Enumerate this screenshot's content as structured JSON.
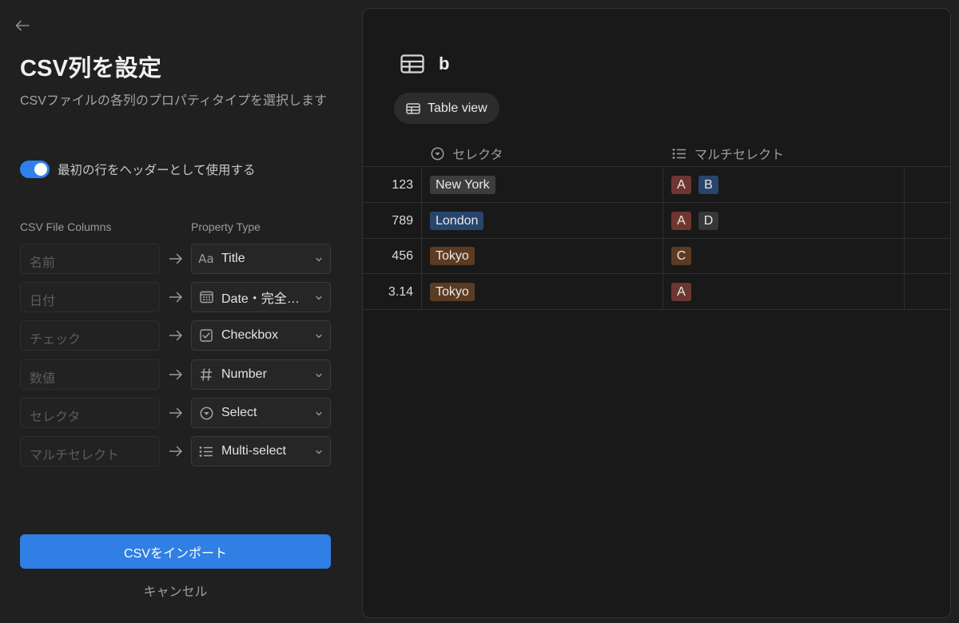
{
  "left": {
    "title": "CSV列を設定",
    "subtitle": "CSVファイルの各列のプロパティタイプを選択します",
    "toggle": {
      "label": "最初の行をヘッダーとして使用する",
      "on": true
    },
    "csv_columns_header": "CSV File Columns",
    "property_type_header": "Property Type",
    "mappings": [
      {
        "column": "名前",
        "type": "Title",
        "icon": "title-aa-icon"
      },
      {
        "column": "日付",
        "type": "Date・完全一致",
        "icon": "calendar-icon"
      },
      {
        "column": "チェック",
        "type": "Checkbox",
        "icon": "checkbox-icon"
      },
      {
        "column": "数値",
        "type": "Number",
        "icon": "hash-icon"
      },
      {
        "column": "セレクタ",
        "type": "Select",
        "icon": "select-icon"
      },
      {
        "column": "マルチセレクト",
        "type": "Multi-select",
        "icon": "list-icon"
      }
    ],
    "import_label": "CSVをインポート",
    "cancel_label": "キャンセル",
    "accent": "#2f7fe4"
  },
  "right": {
    "db_title": "b",
    "view_label": "Table view",
    "columns": [
      {
        "name": "セレクタ",
        "icon": "select-icon"
      },
      {
        "name": "マルチセレクト",
        "icon": "list-icon"
      }
    ],
    "rows": [
      {
        "number": "123",
        "select": "New York",
        "multi": [
          "A",
          "B"
        ]
      },
      {
        "number": "789",
        "select": "London",
        "multi": [
          "A",
          "D"
        ]
      },
      {
        "number": "456",
        "select": "Tokyo",
        "multi": [
          "C"
        ]
      },
      {
        "number": "3.14",
        "select": "Tokyo",
        "multi": [
          "A"
        ]
      }
    ],
    "tag_colors": {
      "New York": "#3d3d3d",
      "London": "#28456c",
      "Tokyo": "#5c3b23",
      "A": "#6e3630",
      "B": "#28456c",
      "C": "#5c3b23",
      "D": "#373737"
    }
  }
}
